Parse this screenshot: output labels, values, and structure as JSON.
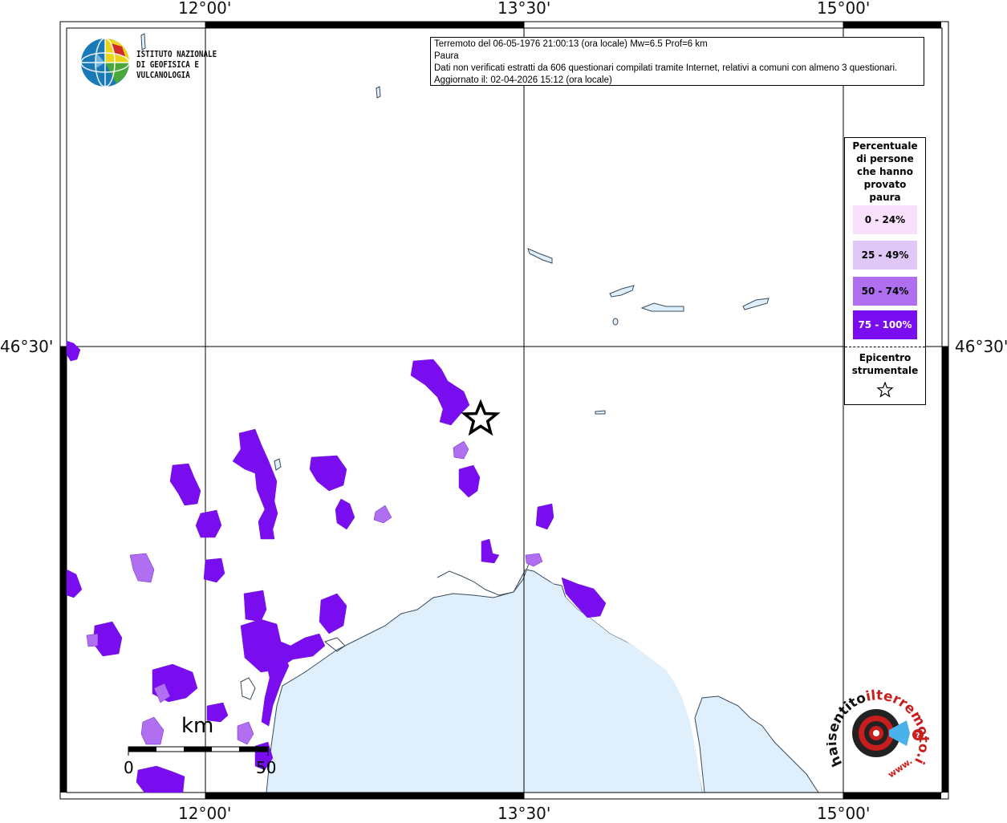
{
  "info": {
    "line1": "Terremoto del 06-05-1976 21:00:13 (ora locale) Mw=6.5 Prof=6 km",
    "line2": "Paura",
    "line3": "Dati non verificati estratti da 606 questionari compilati tramite Internet, relativi a comuni con almeno 3 questionari.",
    "line4": "Aggiornato il: 02-04-2026 15:12 (ora locale)"
  },
  "axes": {
    "top": [
      "12°00'",
      "13°30'",
      "15°00'"
    ],
    "bottom": [
      "12°00'",
      "13°30'",
      "15°00'"
    ],
    "left": [
      "46°30'"
    ],
    "right": [
      "46°30'"
    ]
  },
  "legend": {
    "title_lines": [
      "Percentuale",
      "di persone",
      "che hanno",
      "provato",
      "paura"
    ],
    "classes": [
      {
        "label": "0 - 24%",
        "color": "#f8e0fb",
        "text_color": "#000000"
      },
      {
        "label": "25 - 49%",
        "color": "#dfc8f8",
        "text_color": "#000000"
      },
      {
        "label": "50 - 74%",
        "color": "#b06ef0",
        "text_color": "#000000"
      },
      {
        "label": "75 - 100%",
        "color": "#7a0df0",
        "text_color": "#ffffff"
      }
    ],
    "epicenter_lines": [
      "Epicentro",
      "strumentale"
    ]
  },
  "logo_ingv": {
    "line1": "ISTITUTO NAZIONALE",
    "line2": "DI GEOFISICA E VULCANOLOGIA"
  },
  "scale": {
    "unit": "km",
    "start": "0",
    "end": "50"
  },
  "logo_hsit": {
    "text_black": "haisentito",
    "text_red": "ilterremoto.it",
    "text_www": "www."
  },
  "colors": {
    "sea": "#dff0fc",
    "coast_line": "#3a4a5a",
    "grid": "#000000",
    "lake_fill": "#dff0fc"
  }
}
